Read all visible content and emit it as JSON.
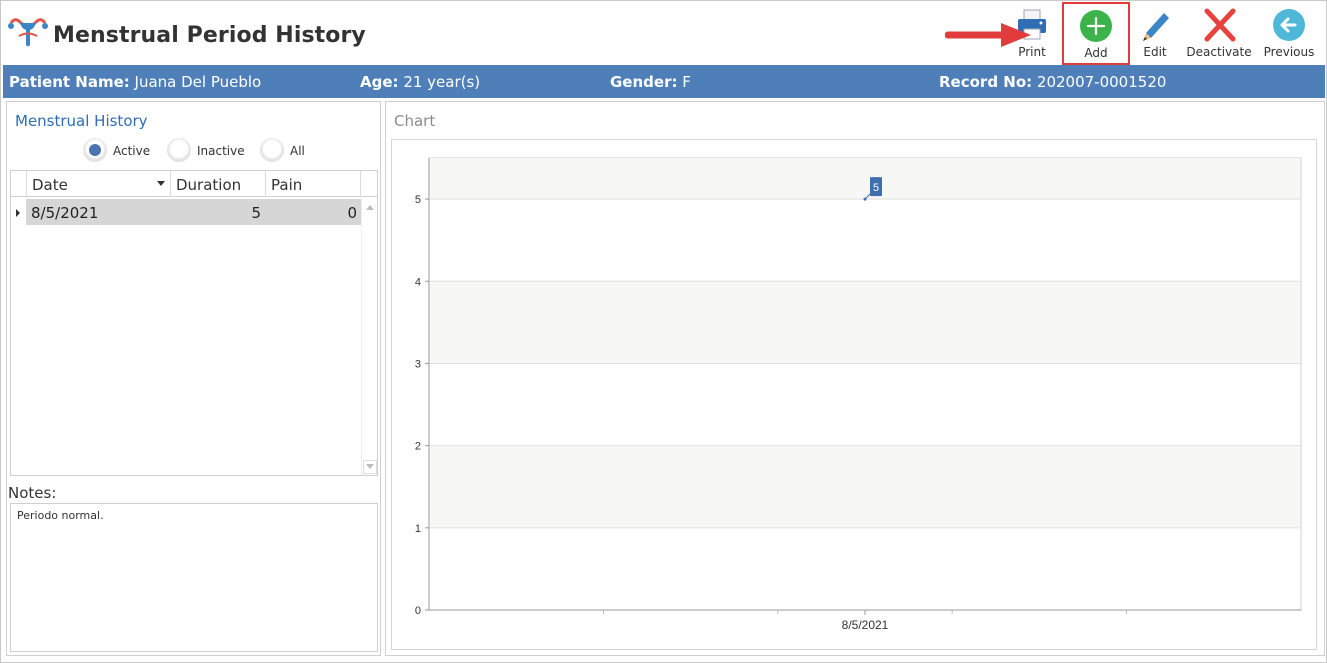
{
  "header": {
    "title": "Menstrual Period History",
    "logo_icon": "uterus-icon"
  },
  "toolbar": {
    "print_label": "Print",
    "add_label": "Add",
    "edit_label": "Edit",
    "deactivate_label": "Deactivate",
    "previous_label": "Previous"
  },
  "patient": {
    "name_label": "Patient Name:",
    "name_value": "Juana Del Pueblo",
    "age_label": "Age:",
    "age_value": "21 year(s)",
    "gender_label": "Gender:",
    "gender_value": "F",
    "record_label": "Record No:",
    "record_value": "202007-0001520"
  },
  "history": {
    "title": "Menstrual History",
    "filters": [
      {
        "label": "Active",
        "selected": true
      },
      {
        "label": "Inactive",
        "selected": false
      },
      {
        "label": "All",
        "selected": false
      }
    ],
    "columns": [
      "Date",
      "Duration",
      "Pain"
    ],
    "rows": [
      {
        "date": "8/5/2021",
        "duration": "5",
        "pain": "0"
      }
    ]
  },
  "notes": {
    "label": "Notes:",
    "text": "Periodo normal."
  },
  "chart_panel": {
    "title": "Chart"
  },
  "colors": {
    "info_bar": "#4f7fb8",
    "accent_blue": "#2f6db5",
    "add_green": "#3bb34a",
    "deactivate_red": "#e8423f",
    "highlight_red": "#e13b3b",
    "label_blue": "#3f6fae"
  },
  "chart_data": {
    "type": "line",
    "categories": [
      "8/5/2021"
    ],
    "series": [
      {
        "values": [
          5
        ]
      }
    ],
    "data_labels": [
      "5"
    ],
    "ylim": [
      0,
      5.5
    ],
    "yticks": [
      0,
      1,
      2,
      3,
      4,
      5
    ],
    "grid": true,
    "legend": "none",
    "title": "",
    "xlabel": "",
    "ylabel": ""
  }
}
